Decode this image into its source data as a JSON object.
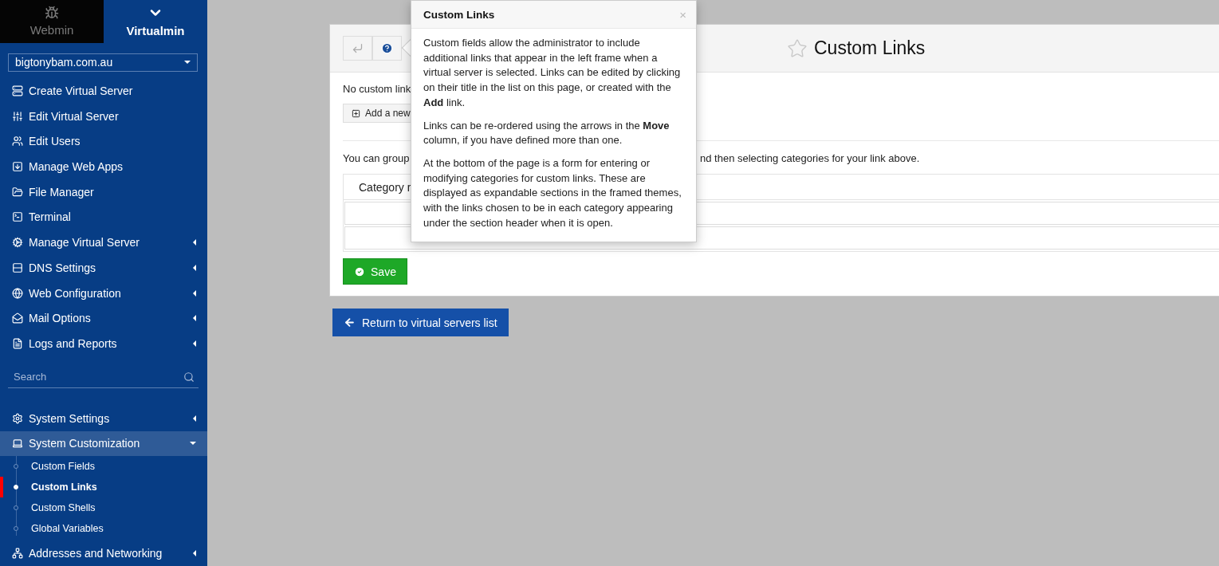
{
  "top_switch": [
    {
      "label": "Webmin",
      "selected": false
    },
    {
      "label": "Virtualmin",
      "selected": true
    }
  ],
  "domain_select": {
    "value": "bigtonybam.com.au"
  },
  "menu": [
    {
      "label": "Create Virtual Server",
      "kind": "create",
      "expandable": false
    },
    {
      "label": "Edit Virtual Server",
      "kind": "edit",
      "expandable": false
    },
    {
      "label": "Edit Users",
      "kind": "users",
      "expandable": false
    },
    {
      "label": "Manage Web Apps",
      "kind": "apps",
      "expandable": false
    },
    {
      "label": "File Manager",
      "kind": "files",
      "expandable": false
    },
    {
      "label": "Terminal",
      "kind": "terminal",
      "expandable": false
    },
    {
      "label": "Manage Virtual Server",
      "kind": "manage",
      "expandable": true
    },
    {
      "label": "DNS Settings",
      "kind": "dns",
      "expandable": true
    },
    {
      "label": "Web Configuration",
      "kind": "web",
      "expandable": true
    },
    {
      "label": "Mail Options",
      "kind": "mail",
      "expandable": true
    },
    {
      "label": "Logs and Reports",
      "kind": "logs",
      "expandable": true
    }
  ],
  "search": {
    "placeholder": "Search"
  },
  "system_menu": [
    {
      "label": "System Settings",
      "kind": "settings",
      "expanded": false
    },
    {
      "label": "System Customization",
      "kind": "custom",
      "expanded": true,
      "children": [
        {
          "label": "Custom Fields",
          "selected": false
        },
        {
          "label": "Custom Links",
          "selected": true
        },
        {
          "label": "Custom Shells",
          "selected": false
        },
        {
          "label": "Global Variables",
          "selected": false
        }
      ]
    },
    {
      "label": "Addresses and Networking",
      "kind": "network",
      "expanded": false
    }
  ],
  "page": {
    "title": "Custom Links",
    "favorite": false
  },
  "content": {
    "no_links_text": "No custom link",
    "add_button": "Add a new",
    "group_text_start": "You can group",
    "group_text_end": "nd then selecting categories for your link above.",
    "table": {
      "columns": [
        "Category r"
      ]
    }
  },
  "save_button": "Save",
  "return_button": "Return to virtual servers list",
  "help_popover": {
    "title": "Custom Links",
    "close": "×",
    "paragraphs": [
      "Custom fields allow the administrator to include additional links that appear in the left frame when a virtual server is selected. Links can be edited by clicking on their title in the list on this page, or created with the **Add** link.",
      "Links can be re-ordered using the arrows in the **Move** column, if you have defined more than one.",
      "At the bottom of the page is a form for entering or modifying categories for custom links. These are displayed as expandable sections in the framed themes, with the links chosen to be in each category appearing under the section header when it is open."
    ]
  }
}
